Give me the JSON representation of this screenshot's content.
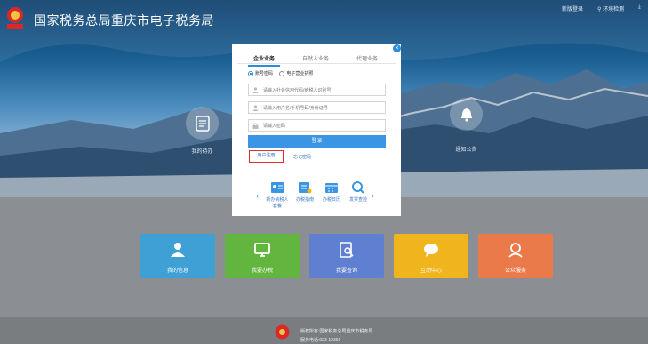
{
  "header": {
    "emblem_text": "国家税务",
    "title": "国家税务总局重庆市电子税务局",
    "nav": [
      "新版登录",
      "环境检测",
      "下载"
    ]
  },
  "side": {
    "left_label": "我的待办",
    "right_label": "通知公告"
  },
  "modal": {
    "tabs": [
      "企业业务",
      "自然人业务",
      "代理业务"
    ],
    "radio_options": [
      "账号密码",
      "电子营业执照"
    ],
    "fields": {
      "credit_code": "请输入社会信用代码/纳税人识别号",
      "user": "请输入用户名/手机号码/身份证号",
      "password": "请输入密码"
    },
    "login_label": "登录",
    "register_label": "用户注册",
    "forgot_label": "忘记密码",
    "services": [
      "新办纳税人套餐",
      "办税指南",
      "办税日历",
      "发票查验"
    ],
    "prev_arrow": "‹",
    "next_arrow": "›",
    "close": "×"
  },
  "tiles": [
    {
      "label": "我的信息",
      "color": "#3fa0d6"
    },
    {
      "label": "我要办税",
      "color": "#62b53f"
    },
    {
      "label": "我要查询",
      "color": "#5f7fd0"
    },
    {
      "label": "互动中心",
      "color": "#f0b41c"
    },
    {
      "label": "公众服务",
      "color": "#ea7a4a"
    }
  ],
  "footer": {
    "copyright": "版权所有:国家税务总局重庆市税务局",
    "phone": "服务电话:023-12366"
  }
}
